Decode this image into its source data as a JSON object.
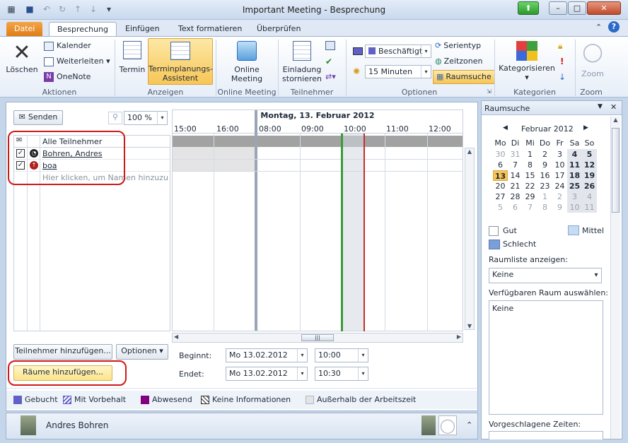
{
  "window": {
    "title": "Important Meeting  -  Besprechung",
    "min": "–",
    "max": "□",
    "close": "✕"
  },
  "tabs": [
    "Datei",
    "Besprechung",
    "Einfügen",
    "Text formatieren",
    "Überprüfen"
  ],
  "ribbon": {
    "aktionen": {
      "delete": "Löschen",
      "calendar": "Kalender",
      "forward": "Weiterleiten",
      "onenote": "OneNote",
      "label": "Aktionen"
    },
    "anzeigen": {
      "appointment": "Termin",
      "assistant_line1": "Terminplanungs-",
      "assistant_line2": "Assistent",
      "label": "Anzeigen"
    },
    "online": {
      "line1": "Online",
      "line2": "Meeting",
      "label": "Online Meeting"
    },
    "teilnehmer": {
      "line1": "Einladung",
      "line2": "stornieren",
      "label": "Teilnehmer"
    },
    "optionen": {
      "status": "Beschäftigt",
      "reminder": "15 Minuten",
      "series": "Serientyp",
      "timezones": "Zeitzonen",
      "roomsearch": "Raumsuche",
      "label": "Optionen"
    },
    "kategorien": {
      "label_btn": "Kategorisieren",
      "label": "Kategorien"
    },
    "zoom": {
      "label_btn": "Zoom",
      "label": "Zoom"
    }
  },
  "scheduler": {
    "send": "Senden",
    "zoom_value": "100 %",
    "date_header": "Montag, 13. Februar 2012",
    "hours": [
      "15:00",
      "16:00",
      "08:00",
      "09:00",
      "10:00",
      "11:00",
      "12:00"
    ],
    "col_all": "Alle Teilnehmer",
    "attendees": [
      {
        "name": "Bohren, Andres",
        "checked": "✓"
      },
      {
        "name": "boa",
        "checked": "✓"
      }
    ],
    "add_placeholder": "Hier klicken, um Namen hinzuzufügen",
    "add_attendees": "Teilnehmer hinzufügen...",
    "options": "Optionen",
    "add_rooms": "Räume hinzufügen...",
    "start_label": "Beginnt:",
    "end_label": "Endet:",
    "start_date": "Mo 13.02.2012",
    "start_time": "10:00",
    "end_date": "Mo 13.02.2012",
    "end_time": "10:30"
  },
  "legend": {
    "booked": "Gebucht",
    "tentative": "Mit Vorbehalt",
    "away": "Abwesend",
    "noinfo": "Keine Informationen",
    "outside": "Außerhalb der Arbeitszeit"
  },
  "status": {
    "user": "Andres Bohren"
  },
  "roompane": {
    "title": "Raumsuche",
    "month": "Februar 2012",
    "weekdays": [
      "Mo",
      "Di",
      "Mi",
      "Do",
      "Fr",
      "Sa",
      "So"
    ],
    "weeks": [
      [
        "30",
        "31",
        "1",
        "2",
        "3",
        "4",
        "5"
      ],
      [
        "6",
        "7",
        "8",
        "9",
        "10",
        "11",
        "12"
      ],
      [
        "13",
        "14",
        "15",
        "16",
        "17",
        "18",
        "19"
      ],
      [
        "20",
        "21",
        "22",
        "23",
        "24",
        "25",
        "26"
      ],
      [
        "27",
        "28",
        "29",
        "1",
        "2",
        "3",
        "4"
      ],
      [
        "5",
        "6",
        "7",
        "8",
        "9",
        "10",
        "11"
      ]
    ],
    "good": "Gut",
    "medium": "Mittel",
    "bad": "Schlecht",
    "roomlist_label": "Raumliste anzeigen:",
    "roomlist_value": "Keine",
    "avail_label": "Verfügbaren Raum auswählen:",
    "avail_value": "Keine",
    "suggested_label": "Vorgeschlagene Zeiten:"
  },
  "colors": {
    "booked": "#6060c8",
    "away": "#800080",
    "accent": "#f3a64a",
    "selection_start": "#3a9a3a",
    "selection_end": "#c03030"
  }
}
